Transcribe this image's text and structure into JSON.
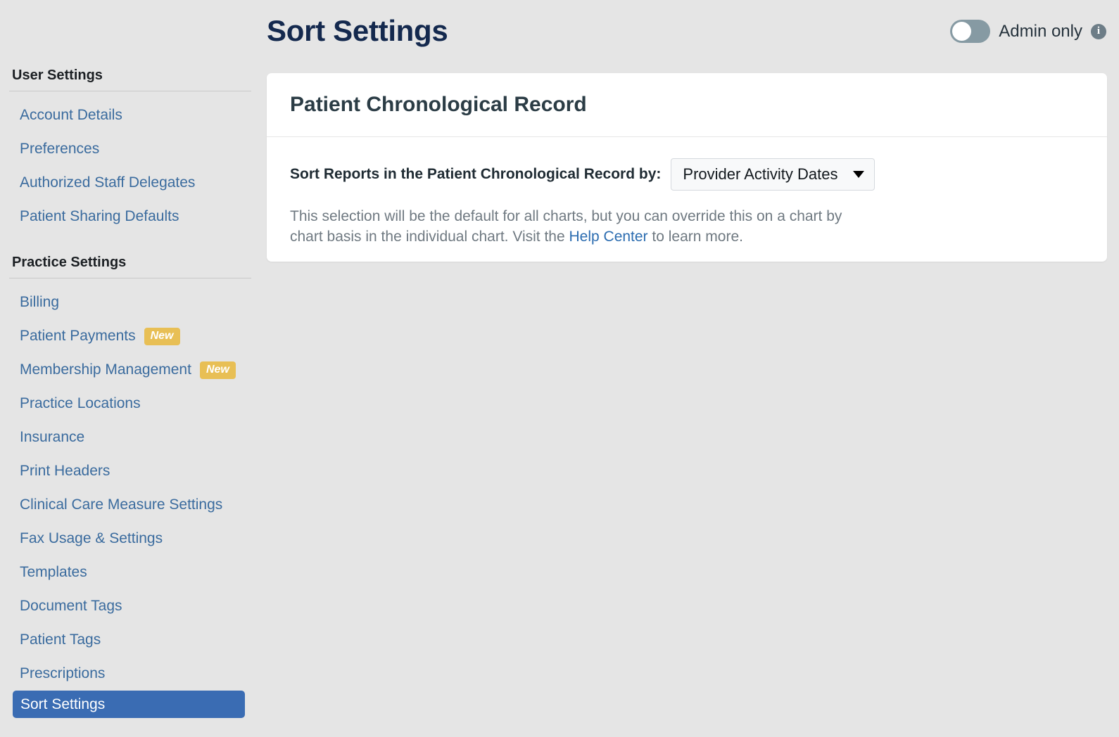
{
  "header": {
    "title": "Sort Settings",
    "admin_toggle": {
      "label": "Admin only",
      "state": "off",
      "info_glyph": "i"
    }
  },
  "sidebar": {
    "sections": [
      {
        "title": "User Settings",
        "items": [
          {
            "label": "Account Details",
            "badge": "",
            "selected": false
          },
          {
            "label": "Preferences",
            "badge": "",
            "selected": false
          },
          {
            "label": "Authorized Staff Delegates",
            "badge": "",
            "selected": false
          },
          {
            "label": "Patient Sharing Defaults",
            "badge": "",
            "selected": false
          }
        ]
      },
      {
        "title": "Practice Settings",
        "items": [
          {
            "label": "Billing",
            "badge": "",
            "selected": false
          },
          {
            "label": "Patient Payments",
            "badge": "New",
            "selected": false
          },
          {
            "label": "Membership Management",
            "badge": "New",
            "selected": false
          },
          {
            "label": "Practice Locations",
            "badge": "",
            "selected": false
          },
          {
            "label": "Insurance",
            "badge": "",
            "selected": false
          },
          {
            "label": "Print Headers",
            "badge": "",
            "selected": false
          },
          {
            "label": "Clinical Care Measure Settings",
            "badge": "",
            "selected": false
          },
          {
            "label": "Fax Usage & Settings",
            "badge": "",
            "selected": false
          },
          {
            "label": "Templates",
            "badge": "",
            "selected": false
          },
          {
            "label": "Document Tags",
            "badge": "",
            "selected": false
          },
          {
            "label": "Patient Tags",
            "badge": "",
            "selected": false
          },
          {
            "label": "Prescriptions",
            "badge": "",
            "selected": false
          },
          {
            "label": "Sort Settings",
            "badge": "",
            "selected": true
          }
        ]
      }
    ]
  },
  "card": {
    "title": "Patient Chronological Record",
    "sort_label": "Sort Reports in the Patient Chronological Record by:",
    "sort_select": {
      "value": "Provider Activity Dates",
      "options": [
        "Provider Activity Dates"
      ]
    },
    "helper": {
      "before_link": "This selection will be the default for all charts, but you can override this on a chart by chart basis in the individual chart. Visit the ",
      "link_text": "Help Center",
      "after_link": " to learn more."
    }
  },
  "colors": {
    "page_background": "#e5e5e5",
    "title_navy": "#14294e",
    "link_blue": "#3a6b9e",
    "selected_blue": "#3a6cb3",
    "badge_gold": "#e8bf55",
    "card_white": "#ffffff",
    "helper_grey": "#6f7981",
    "toggle_track": "#869aa3",
    "info_icon_grey": "#6d7d87"
  }
}
